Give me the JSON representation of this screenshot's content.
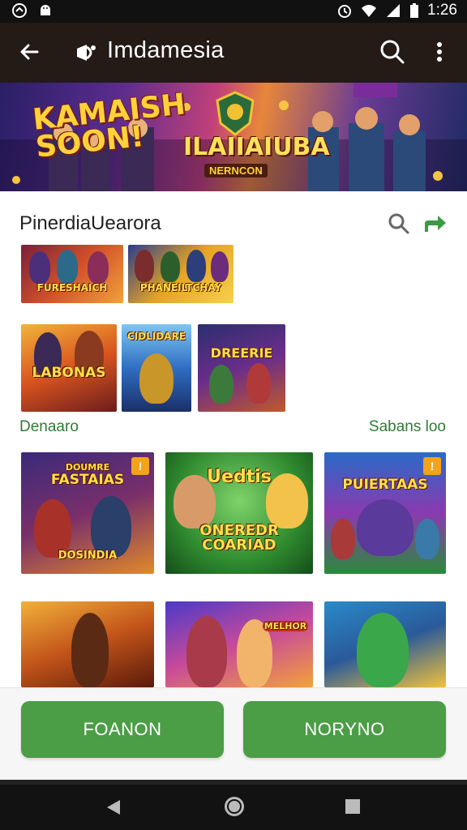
{
  "status_bar": {
    "time": "1:26"
  },
  "app_bar": {
    "title": "Imdamesia"
  },
  "banner": {
    "left_text_line1": "KAMAISH",
    "left_text_line2": "SOON!",
    "center_text": "ILAIIAIUBA",
    "sub_text": "NERNCON"
  },
  "section": {
    "title": "PinerdiaUearora"
  },
  "row1": [
    {
      "label": "FURESHAICH"
    },
    {
      "label": "PHANEILTCHAY"
    }
  ],
  "row2": [
    {
      "label": "LABONAS"
    },
    {
      "label": "CIDLIDARE"
    },
    {
      "label": "DREERIE"
    }
  ],
  "labels": {
    "left": "Denaaro",
    "right": "Sabans loo"
  },
  "grid_row1": [
    {
      "label_top": "DOUMRE",
      "label_main": "FASTAIAS",
      "label_bottom": "DOSINDIA",
      "badge": "!"
    },
    {
      "label_top": "Uedtis",
      "label_main": "ONEREDR",
      "label_bottom": "COARIAD"
    },
    {
      "label_main": "PUIERTAAS",
      "badge": "!"
    }
  ],
  "grid_row2": [
    {
      "label_main": ""
    },
    {
      "label_main": "MELHOR"
    },
    {
      "label_main": ""
    }
  ],
  "actions": {
    "left_label": "FOANON",
    "right_label": "NORYNO"
  },
  "colors": {
    "accent_green": "#4b9d46",
    "app_bar": "#241a16",
    "label_green": "#2e7d32"
  }
}
